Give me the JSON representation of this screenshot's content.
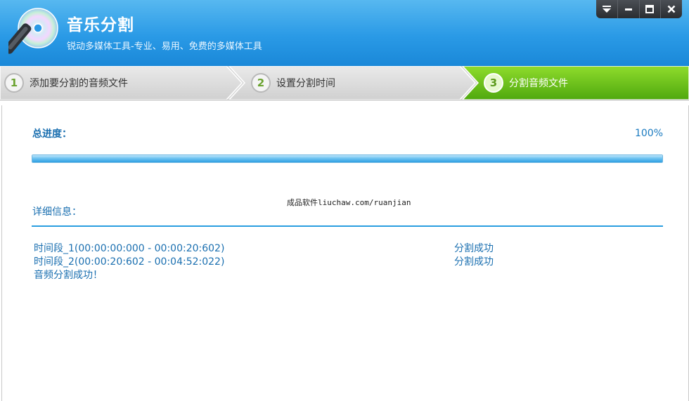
{
  "app": {
    "title": "音乐分割",
    "subtitle": "锐动多媒体工具-专业、易用、免费的多媒体工具"
  },
  "window_controls": [
    "menu-icon",
    "minimize-icon",
    "maximize-icon",
    "close-icon"
  ],
  "steps": [
    {
      "number": "1",
      "label": "添加要分割的音频文件",
      "active": false
    },
    {
      "number": "2",
      "label": "设置分割时间",
      "active": false
    },
    {
      "number": "3",
      "label": "分割音频文件",
      "active": true
    }
  ],
  "progress": {
    "label": "总进度：",
    "percent_text": "100%",
    "value": 1.0
  },
  "watermark": "成品软件liuchaw.com/ruanjian",
  "details": {
    "label": "详细信息：",
    "rows": [
      {
        "segment": "时间段_1(00:00:00:000 - 00:00:20:602)",
        "status": "分割成功"
      },
      {
        "segment": "时间段_2(00:00:20:602 - 00:04:52:022)",
        "status": "分割成功"
      }
    ],
    "final_message": "音频分割成功！"
  },
  "colors": {
    "header": "#2a9ae6",
    "active_step": "#6ac41d",
    "text_blue": "#1a6fb0",
    "progress": "#2f9fe2"
  }
}
